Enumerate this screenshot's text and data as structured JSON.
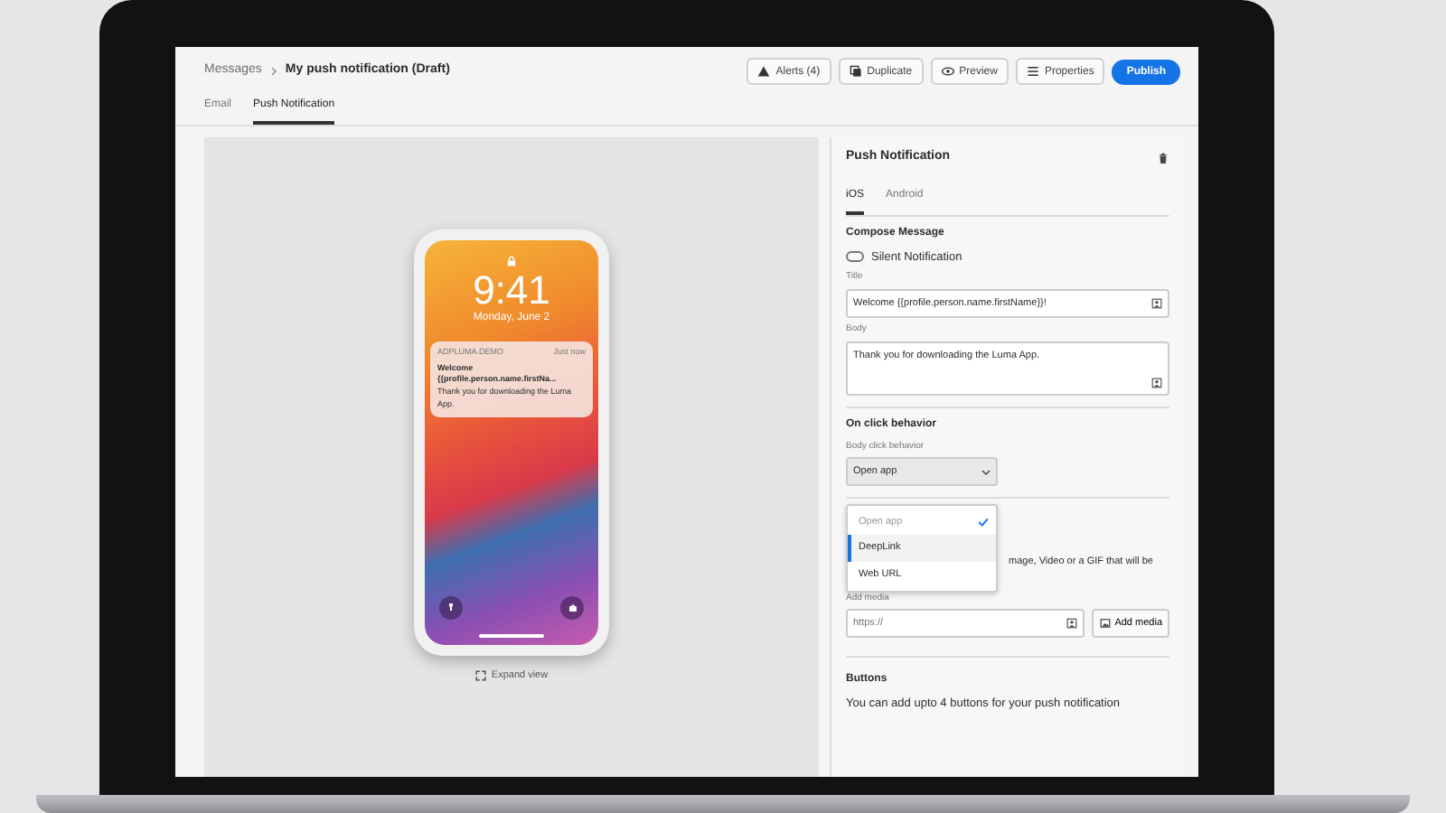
{
  "header": {
    "breadcrumb": [
      {
        "label": "Messages"
      },
      {
        "label": "My push notification (Draft)"
      }
    ],
    "actions": [
      {
        "label": "Alerts (4)",
        "kind": "alert"
      },
      {
        "label": "Duplicate",
        "kind": "duplicate"
      },
      {
        "label": "Preview",
        "kind": "preview"
      },
      {
        "label": "Properties",
        "kind": "properties"
      },
      {
        "label": "Publish",
        "kind": "primary"
      }
    ]
  },
  "tabs": [
    {
      "label": "Email",
      "selected": false
    },
    {
      "label": "Push Notification",
      "selected": true
    }
  ],
  "preview": {
    "time": "9:41",
    "date": "Monday, June 2",
    "notification": {
      "app": "ADPLUMA.DEMO",
      "when": "Just now",
      "title": "Welcome {{profile.person.name.firstNa...",
      "body": "Thank you for downloading the Luma App."
    },
    "expand": "Expand view"
  },
  "panel": {
    "title": "Push Notification",
    "platform_tabs": [
      {
        "label": "iOS",
        "selected": true
      },
      {
        "label": "Android",
        "selected": false
      }
    ],
    "compose": {
      "heading": "Compose Message",
      "silent": {
        "label": "Silent Notification",
        "on": false
      },
      "title_field": {
        "label": "Title",
        "value": "Welcome {{profile.person.name.firstName}}!"
      },
      "body_field": {
        "label": "Body",
        "value": "Thank you for downloading the Luma App."
      }
    },
    "click": {
      "heading": "On click behavior",
      "label": "Body click behavior",
      "value": "Open app",
      "options": [
        {
          "label": "Open app",
          "selected": true,
          "focused": false
        },
        {
          "label": "DeepLink",
          "selected": false,
          "focused": true
        },
        {
          "label": "Web URL",
          "selected": false,
          "focused": false
        }
      ]
    },
    "media": {
      "description": "mage, Video or a GIF that will be",
      "label": "Add media",
      "placeholder": "https://",
      "button": "Add media"
    },
    "buttons": {
      "heading": "Buttons",
      "description": "You can add upto 4 buttons for your push notification"
    }
  }
}
